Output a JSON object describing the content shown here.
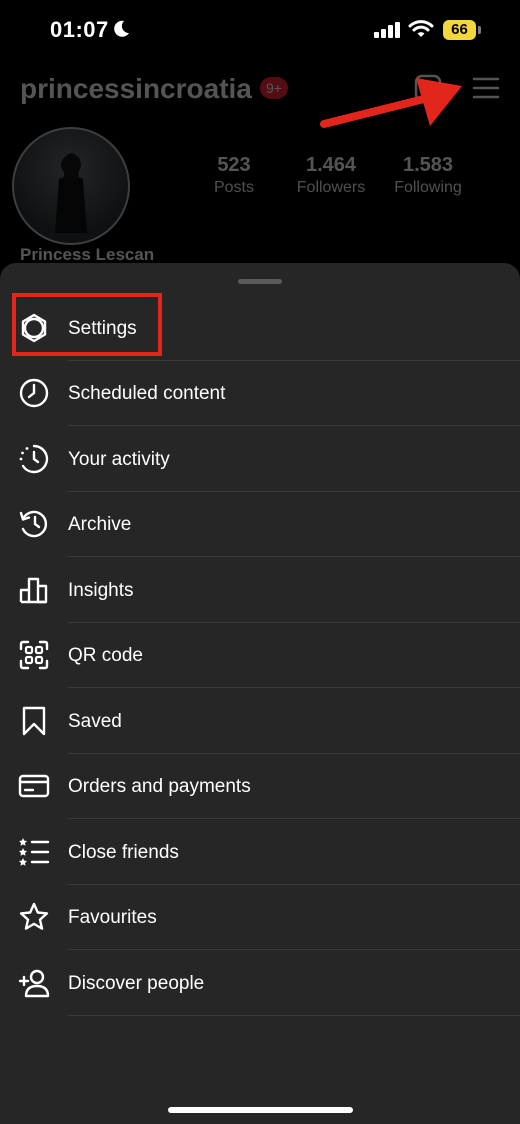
{
  "status_bar": {
    "time": "01:07",
    "battery": "66"
  },
  "profile": {
    "username": "princessincroatia",
    "notification_count": "9+",
    "display_name": "Princess Lescan",
    "stats": [
      {
        "value": "523",
        "label": "Posts"
      },
      {
        "value": "1.464",
        "label": "Followers"
      },
      {
        "value": "1.583",
        "label": "Following"
      }
    ]
  },
  "menu": {
    "items": [
      {
        "label": "Settings",
        "icon": "settings-gear-icon"
      },
      {
        "label": "Scheduled content",
        "icon": "clock-icon"
      },
      {
        "label": "Your activity",
        "icon": "activity-icon"
      },
      {
        "label": "Archive",
        "icon": "archive-icon"
      },
      {
        "label": "Insights",
        "icon": "insights-chart-icon"
      },
      {
        "label": "QR code",
        "icon": "qr-code-icon"
      },
      {
        "label": "Saved",
        "icon": "bookmark-icon"
      },
      {
        "label": "Orders and payments",
        "icon": "credit-card-icon"
      },
      {
        "label": "Close friends",
        "icon": "close-friends-list-icon"
      },
      {
        "label": "Favourites",
        "icon": "star-icon"
      },
      {
        "label": "Discover people",
        "icon": "add-person-icon"
      }
    ]
  },
  "colors": {
    "highlight": "#e3261c",
    "sheet_bg": "#262626",
    "battery": "#f4d73a"
  }
}
